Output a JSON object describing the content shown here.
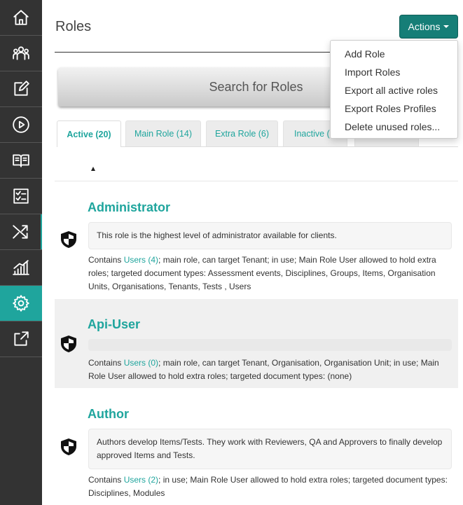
{
  "sidebar": {
    "items": [
      {
        "icon": "home-icon"
      },
      {
        "icon": "users-icon"
      },
      {
        "icon": "edit-icon"
      },
      {
        "icon": "play-icon"
      },
      {
        "icon": "book-icon"
      },
      {
        "icon": "checklist-icon"
      },
      {
        "icon": "shuffle-icon"
      },
      {
        "icon": "chart-icon"
      },
      {
        "icon": "gear-icon",
        "active": true
      },
      {
        "icon": "share-icon"
      }
    ],
    "accent": "#1fa59d"
  },
  "header": {
    "title": "Roles",
    "actions_label": "Actions"
  },
  "search": {
    "label": "Search for Roles"
  },
  "tabs": [
    {
      "label": "Active (20)"
    },
    {
      "label": "Main Role (14)"
    },
    {
      "label": "Extra Role (6)"
    },
    {
      "label": "Inactive ("
    }
  ],
  "actions_menu": {
    "items": [
      "Add Role",
      "Import Roles",
      "Export all active roles",
      "Export Roles Profiles",
      "Delete unused roles..."
    ]
  },
  "roles": [
    {
      "name": "Administrator",
      "description": "This role is the highest level of administrator available for clients.",
      "contains_prefix": "Contains ",
      "users_link": "Users (4)",
      "details": "; main role, can target Tenant; in use; Main Role User allowed to hold extra roles; targeted document types: Assessment events, Disciplines, Groups, Items, Organisation Units, Organisations, Tenants, Tests , Users"
    },
    {
      "name": "Api-User",
      "description": "",
      "contains_prefix": "Contains ",
      "users_link": "Users (0)",
      "details": "; main role, can target Tenant, Organisation, Organisation Unit; in use; Main Role User allowed to hold extra roles; targeted document types: (none)"
    },
    {
      "name": "Author",
      "description": "Authors develop Items/Tests. They work with Reviewers, QA and Approvers to finally develop approved Items and Tests.",
      "contains_prefix": "Contains ",
      "users_link": "Users (2)",
      "details": "; in use; Main Role User allowed to hold extra roles; targeted document types: Disciplines, Modules"
    }
  ]
}
